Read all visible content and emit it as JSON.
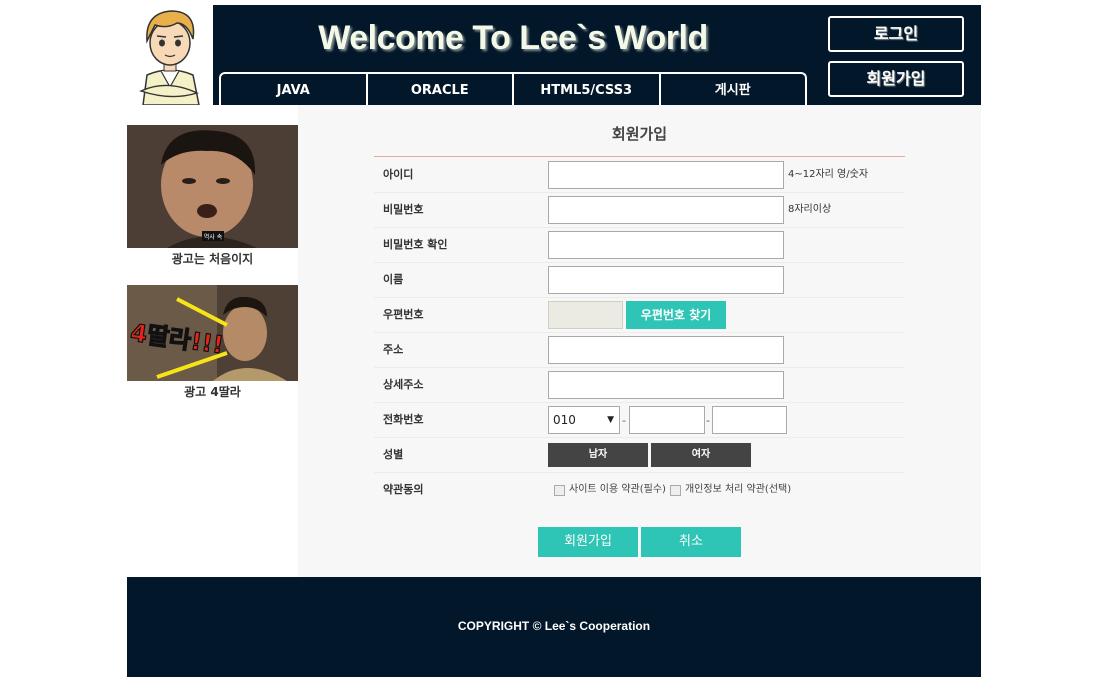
{
  "header": {
    "title": "Welcome To Lee`s World",
    "login_label": "로그인",
    "join_label": "회원가입",
    "nav": [
      "JAVA",
      "ORACLE",
      "HTML5/CSS3",
      "게시판"
    ]
  },
  "sidebar": {
    "ads": [
      {
        "caption": "광고는 처음이지",
        "image_text": "역사 속"
      },
      {
        "caption": "광고 4딸라",
        "image_text": "4딸라!!!"
      }
    ]
  },
  "form": {
    "title": "회원가입",
    "fields": {
      "id_label": "아이디",
      "id_hint": "4~12자리 영/숫자",
      "pw_label": "비밀번호",
      "pw_hint": "8자리이상",
      "pw_confirm_label": "비밀번호 확인",
      "name_label": "이름",
      "zip_label": "우편번호",
      "zip_button": "우편번호 찾기",
      "addr_label": "주소",
      "addr_detail_label": "상세주소",
      "phone_label": "전화번호",
      "phone_prefix": "010",
      "phone_dash": "-",
      "gender_label": "성별",
      "male": "남자",
      "female": "여자",
      "terms_label": "약관동의",
      "terms_site": "사이트 이용 약관(필수)",
      "terms_privacy": "개인정보 처리 약관(선택)"
    },
    "submit_label": "회원가입",
    "cancel_label": "취소"
  },
  "footer": {
    "copyright": "COPYRIGHT © Lee`s Cooperation"
  },
  "colors": {
    "header_bg": "#03172a",
    "accent": "#2ec4b6",
    "dark_button": "#444444",
    "form_bg": "#f7f7f7"
  }
}
